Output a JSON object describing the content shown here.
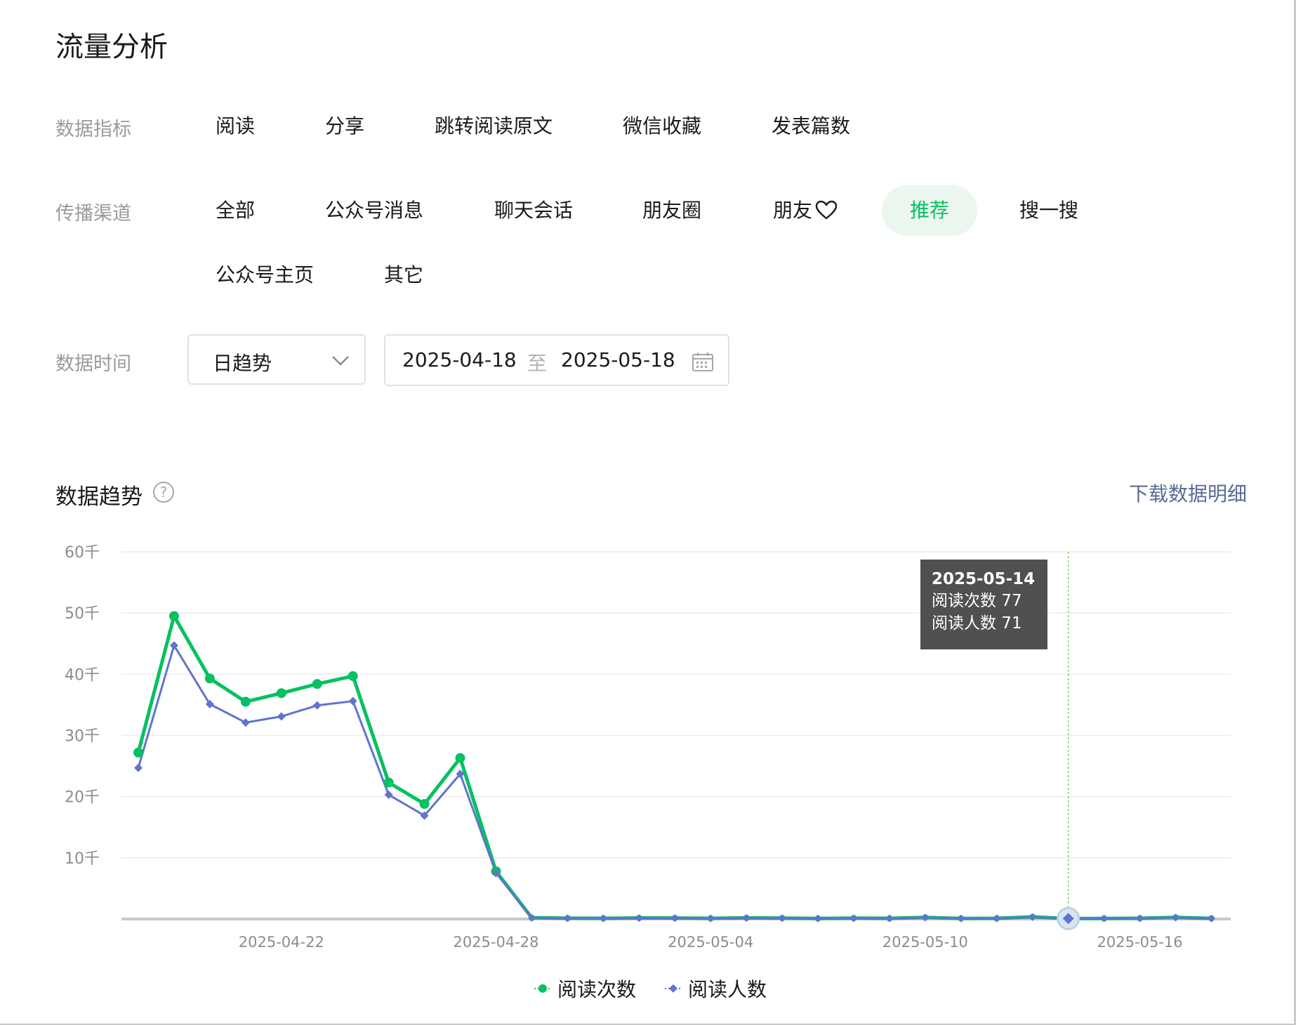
{
  "page_title": "流量分析",
  "metrics": {
    "label": "数据指标",
    "items": [
      {
        "label": "阅读",
        "active": true
      },
      {
        "label": "分享",
        "active": false
      },
      {
        "label": "跳转阅读原文",
        "active": false
      },
      {
        "label": "微信收藏",
        "active": false
      },
      {
        "label": "发表篇数",
        "active": false
      }
    ]
  },
  "channels": {
    "label": "传播渠道",
    "items": [
      {
        "label": "全部",
        "active": false
      },
      {
        "label": "公众号消息",
        "active": false
      },
      {
        "label": "聊天会话",
        "active": false
      },
      {
        "label": "朋友圈",
        "active": false
      },
      {
        "label": "朋友",
        "active": false,
        "icon": "heart-icon"
      },
      {
        "label": "推荐",
        "active": true
      },
      {
        "label": "搜一搜",
        "active": false
      },
      {
        "label": "公众号主页",
        "active": false
      },
      {
        "label": "其它",
        "active": false
      }
    ]
  },
  "time": {
    "label": "数据时间",
    "granularity": "日趋势",
    "start_date": "2025-04-18",
    "separator": "至",
    "end_date": "2025-05-18"
  },
  "trend": {
    "title": "数据趋势",
    "help_icon": "question-circle-icon",
    "download_label": "下载数据明细"
  },
  "tooltip": {
    "date": "2025-05-14",
    "rows": [
      "阅读次数 77",
      "阅读人数 71"
    ]
  },
  "colors": {
    "accent": "#07c160",
    "series_reads": "#07c160",
    "series_readers": "#6173cf",
    "link": "#576b95",
    "active_pill_bg": "#eaf6ee"
  },
  "chart_data": {
    "type": "line",
    "x": [
      "2025-04-18",
      "2025-04-19",
      "2025-04-20",
      "2025-04-21",
      "2025-04-22",
      "2025-04-23",
      "2025-04-24",
      "2025-04-25",
      "2025-04-26",
      "2025-04-27",
      "2025-04-28",
      "2025-04-29",
      "2025-04-30",
      "2025-05-01",
      "2025-05-02",
      "2025-05-03",
      "2025-05-04",
      "2025-05-05",
      "2025-05-06",
      "2025-05-07",
      "2025-05-08",
      "2025-05-09",
      "2025-05-10",
      "2025-05-11",
      "2025-05-12",
      "2025-05-13",
      "2025-05-14",
      "2025-05-15",
      "2025-05-16",
      "2025-05-17",
      "2025-05-18"
    ],
    "x_ticks": [
      "2025-04-22",
      "2025-04-28",
      "2025-05-04",
      "2025-05-10",
      "2025-05-16"
    ],
    "y_ticks": [
      "60千",
      "50千",
      "40千",
      "30千",
      "20千",
      "10千"
    ],
    "ylim": [
      0,
      60000
    ],
    "grid": true,
    "legend_position": "bottom",
    "highlight": "2025-05-14",
    "series": [
      {
        "name": "阅读次数",
        "color": "#07c160",
        "marker": "circle",
        "values": [
          27200,
          49500,
          39300,
          35500,
          36900,
          38400,
          39700,
          22300,
          18800,
          26300,
          7800,
          200,
          130,
          110,
          170,
          160,
          110,
          180,
          150,
          90,
          140,
          110,
          260,
          90,
          110,
          350,
          77,
          90,
          120,
          260,
          100
        ]
      },
      {
        "name": "阅读人数",
        "color": "#6173cf",
        "marker": "diamond",
        "values": [
          24700,
          44700,
          35100,
          32100,
          33100,
          34900,
          35600,
          20300,
          16900,
          23700,
          7500,
          180,
          120,
          100,
          150,
          140,
          100,
          160,
          130,
          80,
          120,
          100,
          230,
          80,
          100,
          300,
          71,
          80,
          110,
          230,
          90
        ]
      }
    ]
  }
}
